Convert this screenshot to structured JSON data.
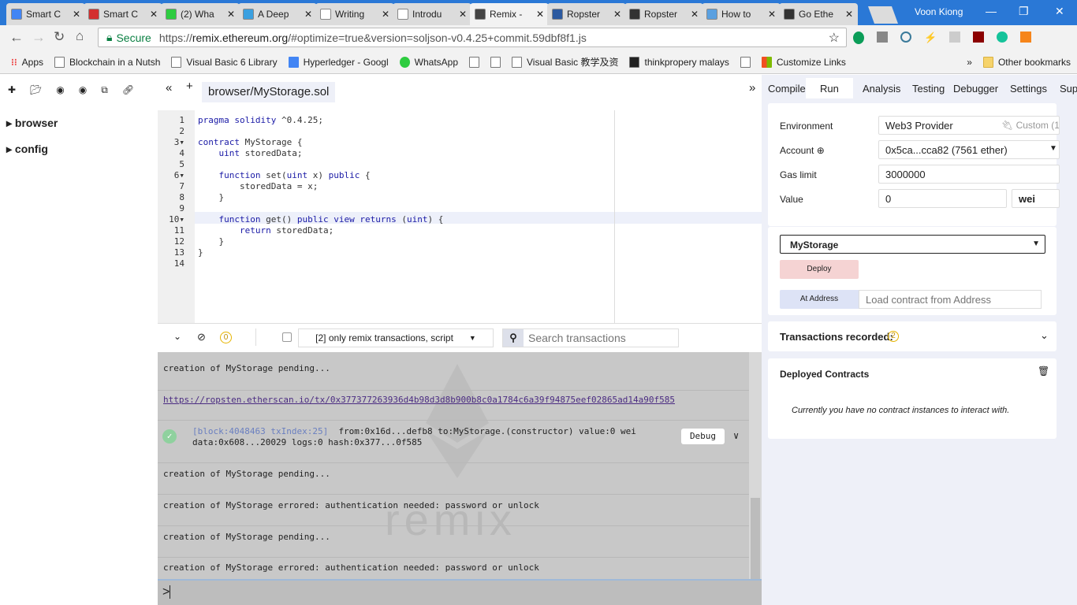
{
  "browser": {
    "tabs": [
      {
        "title": "Smart C",
        "color": "#4285f4"
      },
      {
        "title": "Smart C",
        "color": "#d32f2f"
      },
      {
        "title": "(2) Wha",
        "color": "#2ecc40"
      },
      {
        "title": "A Deep",
        "color": "#3ba0e0"
      },
      {
        "title": "Writing",
        "color": "#ffffff"
      },
      {
        "title": "Introdu",
        "color": "#ffffff"
      },
      {
        "title": "Remix -",
        "color": "#444444",
        "active": true
      },
      {
        "title": "Ropster",
        "color": "#2c5aa0"
      },
      {
        "title": "Ropster",
        "color": "#333333"
      },
      {
        "title": "How to",
        "color": "#5aa0e0"
      },
      {
        "title": "Go Ethe",
        "color": "#333333"
      }
    ],
    "user": "Voon Kiong",
    "secure_label": "Secure",
    "url_scheme": "https://",
    "url_host": "remix.ethereum.org",
    "url_rest": "/#optimize=true&version=soljson-v0.4.25+commit.59dbf8f1.js",
    "bookmarks": [
      "Apps",
      "Blockchain in a Nutsh",
      "Visual Basic 6 Library",
      "Hyperledger - Googl",
      "WhatsApp",
      "",
      "",
      "Visual Basic 教学及资",
      "thinkpropery malays",
      "",
      "Customize Links"
    ],
    "more": "»",
    "other_bookmarks": "Other bookmarks"
  },
  "files": {
    "folders": [
      "browser",
      "config"
    ]
  },
  "editor": {
    "tab": "browser/MyStorage.sol",
    "lines": [
      "pragma solidity ^0.4.25;",
      "",
      "contract MyStorage {",
      "    uint storedData;",
      "",
      "    function set(uint x) public {",
      "        storedData = x;",
      "    }",
      "",
      "    function get() public view returns (uint) {",
      "        return storedData;",
      "    }",
      "}",
      ""
    ]
  },
  "terminal": {
    "pending_count": "0",
    "filter": "[2] only remix transactions, script",
    "search_placeholder": "Search transactions",
    "log1": "creation of MyStorage pending...",
    "link": "https://ropsten.etherscan.io/tx/0x377377263936d4b98d3d8b900b8c0a1784c6a39f94875eef02865ad14a90f585",
    "tx_block": "[block:4048463 txIndex:25]",
    "tx_line1": "from:0x16d...defb8 to:MyStorage.(constructor) value:0 wei",
    "tx_line2": "data:0x608...20029 logs:0 hash:0x377...0f585",
    "debug": "Debug",
    "log2": "creation of MyStorage pending...",
    "log3": "creation of MyStorage errored: authentication needed: password or unlock",
    "log4": "creation of MyStorage pending...",
    "log5": "creation of MyStorage errored: authentication needed: password or unlock",
    "prompt": ">",
    "watermark": "remix"
  },
  "right": {
    "tabs": [
      "Compile",
      "Run",
      "Analysis",
      "Testing",
      "Debugger",
      "Settings",
      "Suppo"
    ],
    "active_tab": "Run",
    "environment_label": "Environment",
    "environment": "Web3 Provider",
    "environment_extra": "Custom (1",
    "account_label": "Account",
    "account": "0x5ca...cca82 (7561 ether)",
    "gas_label": "Gas limit",
    "gas": "3000000",
    "value_label": "Value",
    "value": "0",
    "unit": "wei",
    "contract": "MyStorage",
    "deploy": "Deploy",
    "at_address": "At Address",
    "address_placeholder": "Load contract from Address",
    "tx_recorded": "Transactions recorded:",
    "tx_count": "2",
    "deployed": "Deployed Contracts",
    "no_instances": "Currently you have no contract instances to interact with."
  }
}
